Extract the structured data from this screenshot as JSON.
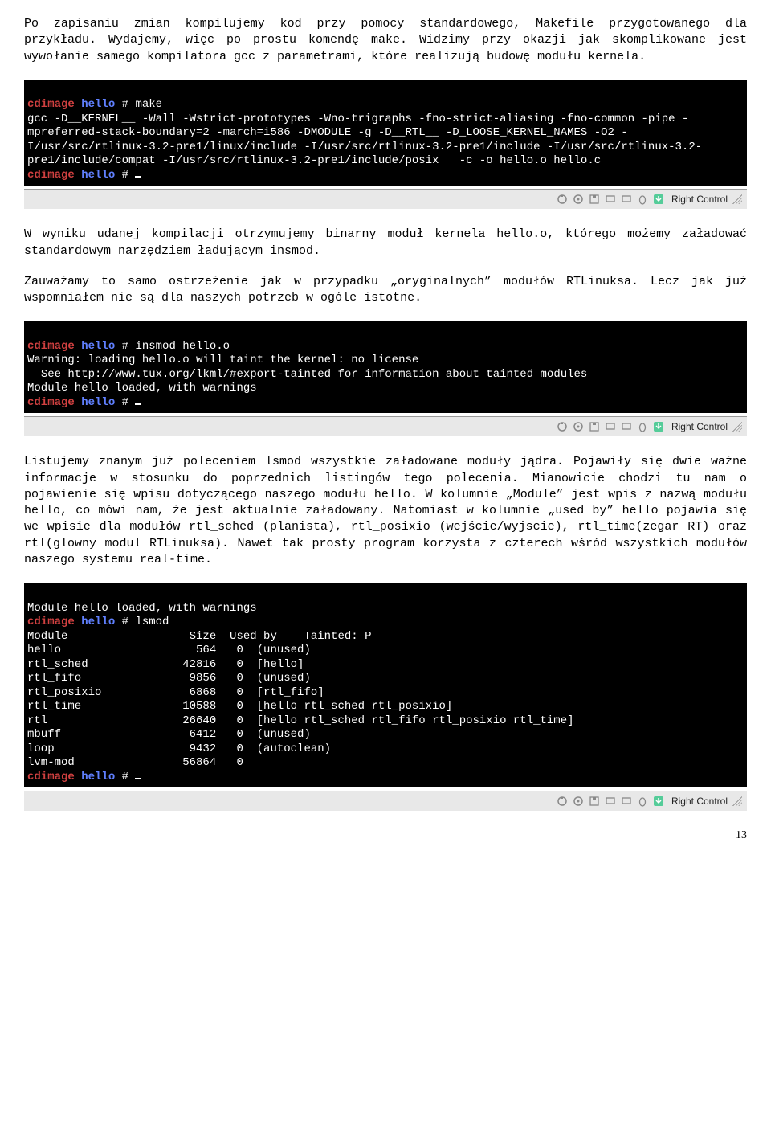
{
  "p1": "Po zapisaniu zmian kompilujemy kod przy pomocy standardowego, Makefile przygotowanego dla przykładu. Wydajemy, więc po prostu komendę make. Widzimy przy okazji jak skomplikowane jest wywołanie samego kompilatora gcc z parametrami, które realizują budowę modułu kernela.",
  "term1": {
    "host": "cdimage",
    "dir": "hello",
    "cmd1": "make",
    "body": "gcc -D__KERNEL__ -Wall -Wstrict-prototypes -Wno-trigraphs -fno-strict-aliasing -fno-common -pipe -mpreferred-stack-boundary=2 -march=i586 -DMODULE -g -D__RTL__ -D_LOOSE_KERNEL_NAMES -O2 -I/usr/src/rtlinux-3.2-pre1/linux/include -I/usr/src/rtlinux-3.2-pre1/include -I/usr/src/rtlinux-3.2-pre1/include/compat -I/usr/src/rtlinux-3.2-pre1/include/posix   -c -o hello.o hello.c"
  },
  "p2": "W wyniku udanej kompilacji otrzymujemy binarny moduł kernela hello.o, którego możemy załadować standardowym narzędziem ładującym insmod.",
  "p3": "Zauważamy to samo ostrzeżenie jak w przypadku „oryginalnych” modułów RTLinuksa. Lecz jak już wspomniałem nie są dla naszych potrzeb w ogóle istotne.",
  "term2": {
    "host": "cdimage",
    "dir": "hello",
    "cmd1": "insmod hello.o",
    "body": "Warning: loading hello.o will taint the kernel: no license\n  See http://www.tux.org/lkml/#export-tainted for information about tainted modules\nModule hello loaded, with warnings"
  },
  "p4": "Listujemy znanym już poleceniem lsmod wszystkie załadowane moduły jądra. Pojawiły się dwie ważne informacje w stosunku do poprzednich listingów tego polecenia. Mianowicie chodzi tu nam o pojawienie się wpisu dotyczącego naszego modułu hello. W kolumnie „Module” jest wpis z nazwą modułu hello, co mówi nam, że jest aktualnie załadowany. Natomiast w kolumnie „used by” hello pojawia się we wpisie dla modułów rtl_sched (planista), rtl_posixio (wejście/wyjscie), rtl_time(zegar RT) oraz rtl(glowny modul RTLinuksa). Nawet tak prosty program korzysta z czterech wśród wszystkich modułów naszego systemu real-time.",
  "term3": {
    "pre": "Module hello loaded, with warnings",
    "host": "cdimage",
    "dir": "hello",
    "cmd1": "lsmod",
    "header": "Module                  Size  Used by    Tainted: P",
    "rows": [
      "hello                    564   0  (unused)",
      "rtl_sched              42816   0  [hello]",
      "rtl_fifo                9856   0  (unused)",
      "rtl_posixio             6868   0  [rtl_fifo]",
      "rtl_time               10588   0  [hello rtl_sched rtl_posixio]",
      "rtl                    26640   0  [hello rtl_sched rtl_fifo rtl_posixio rtl_time]",
      "mbuff                   6412   0  (unused)",
      "loop                    9432   0  (autoclean)",
      "lvm-mod                56864   0"
    ]
  },
  "vmbar": {
    "label": "Right Control"
  },
  "pagenum": "13"
}
